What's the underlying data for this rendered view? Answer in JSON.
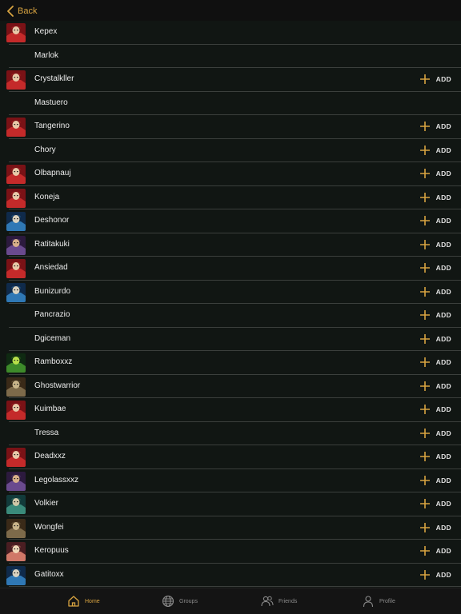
{
  "nav": {
    "back_label": "Back"
  },
  "users": [
    {
      "name": "Kepex",
      "avatar": "red",
      "add": false
    },
    {
      "name": "Marlok",
      "avatar": "none",
      "add": false
    },
    {
      "name": "Crystalkller",
      "avatar": "red",
      "add": true
    },
    {
      "name": "Mastuero",
      "avatar": "none",
      "add": false
    },
    {
      "name": "Tangerino",
      "avatar": "red",
      "add": true
    },
    {
      "name": "Chory",
      "avatar": "none",
      "add": true
    },
    {
      "name": "Olbapnauj",
      "avatar": "red",
      "add": true
    },
    {
      "name": "Koneja",
      "avatar": "red",
      "add": true
    },
    {
      "name": "Deshonor",
      "avatar": "blue",
      "add": true
    },
    {
      "name": "Ratitakuki",
      "avatar": "purple",
      "add": true
    },
    {
      "name": "Ansiedad",
      "avatar": "red",
      "add": true
    },
    {
      "name": "Bunizurdo",
      "avatar": "blue",
      "add": true
    },
    {
      "name": "Pancrazio",
      "avatar": "none",
      "add": true
    },
    {
      "name": "Dgiceman",
      "avatar": "none",
      "add": true
    },
    {
      "name": "Ramboxxz",
      "avatar": "green",
      "add": true
    },
    {
      "name": "Ghostwarrior",
      "avatar": "brown",
      "add": true
    },
    {
      "name": "Kuimbae",
      "avatar": "red",
      "add": true
    },
    {
      "name": "Tressa",
      "avatar": "none",
      "add": true
    },
    {
      "name": "Deadxxz",
      "avatar": "red",
      "add": true
    },
    {
      "name": "Legolassxxz",
      "avatar": "purple",
      "add": true
    },
    {
      "name": "Volkier",
      "avatar": "teal",
      "add": true
    },
    {
      "name": "Wongfei",
      "avatar": "brown",
      "add": true
    },
    {
      "name": "Keropuus",
      "avatar": "pink",
      "add": true
    },
    {
      "name": "Gatitoxx",
      "avatar": "blue",
      "add": true
    }
  ],
  "add_label": "ADD",
  "tabs": [
    {
      "label": "Home",
      "icon": "home-icon",
      "active": true
    },
    {
      "label": "Groups",
      "icon": "globe-icon",
      "active": false
    },
    {
      "label": "Friends",
      "icon": "people-icon",
      "active": false
    },
    {
      "label": "Profile",
      "icon": "person-icon",
      "active": false
    }
  ],
  "colors": {
    "accent": "#d9a441",
    "background": "#111613",
    "divider": "#3b3f3c"
  }
}
